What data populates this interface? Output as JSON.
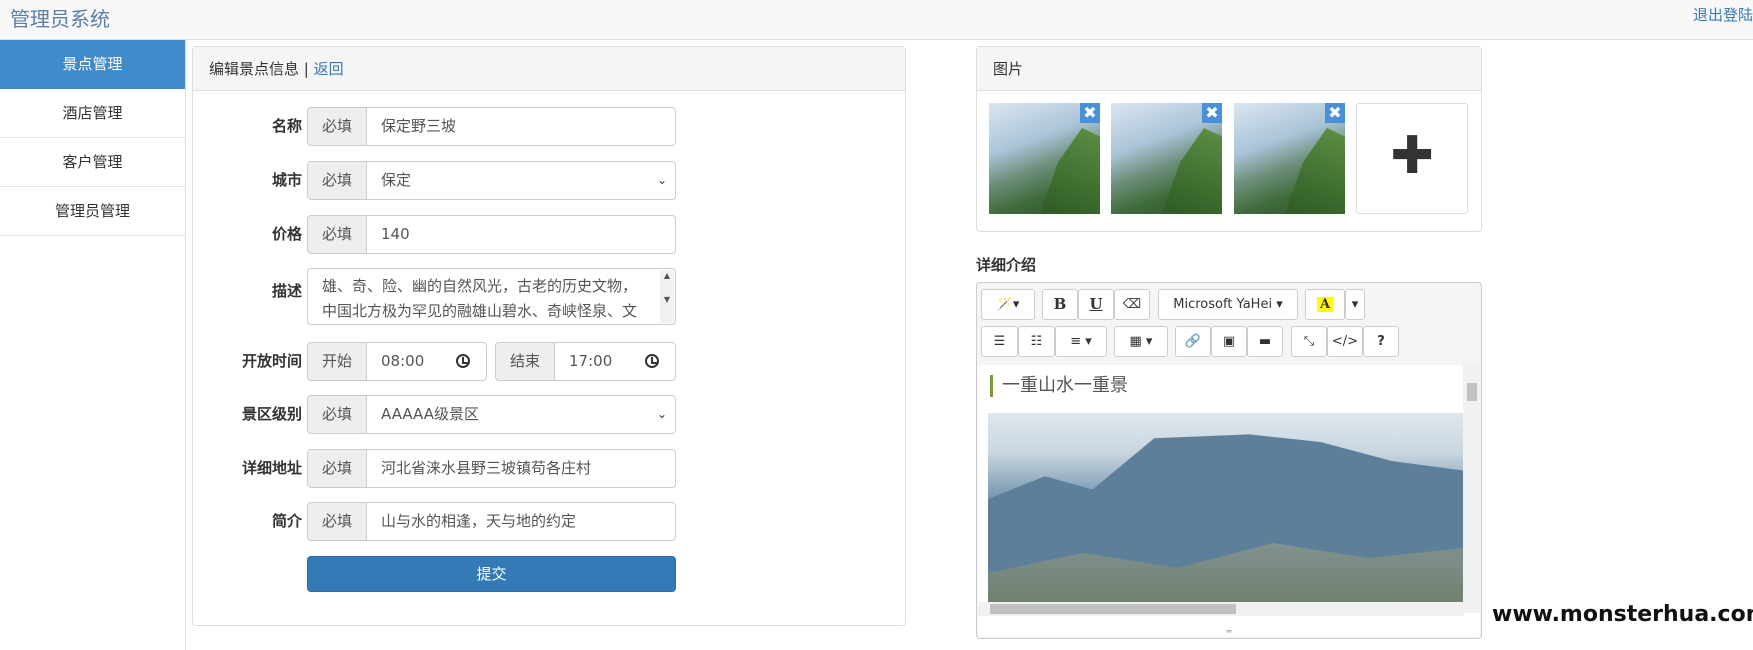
{
  "header": {
    "brand": "管理员系统",
    "logout": "退出登陆"
  },
  "sidebar": {
    "items": [
      {
        "label": "景点管理",
        "active": true
      },
      {
        "label": "酒店管理"
      },
      {
        "label": "客户管理"
      },
      {
        "label": "管理员管理"
      }
    ]
  },
  "form": {
    "title": "编辑景点信息",
    "back": "返回",
    "name": {
      "label": "名称",
      "addon": "必填",
      "value": "保定野三坡"
    },
    "city": {
      "label": "城市",
      "addon": "必填",
      "value": "保定"
    },
    "price": {
      "label": "价格",
      "addon": "必填",
      "value": "140"
    },
    "desc": {
      "label": "描述",
      "value": "雄、奇、险、幽的自然风光，古老的历史文物，中国北方极为罕见的融雄山碧水、奇峡怪泉、文物古迹、名树古禅于一身的风景名胜"
    },
    "open": {
      "label": "开放时间",
      "start_addon": "开始",
      "start": "08:00",
      "end_addon": "结束",
      "end": "17:00"
    },
    "level": {
      "label": "景区级别",
      "addon": "必填",
      "value": "AAAAA级景区"
    },
    "address": {
      "label": "详细地址",
      "addon": "必填",
      "value": "河北省涞水县野三坡镇苟各庄村"
    },
    "intro": {
      "label": "简介",
      "addon": "必填",
      "value": "山与水的相逢，天与地的约定"
    },
    "submit": "提交"
  },
  "images": {
    "title": "图片",
    "delete_glyph": "✖",
    "add_glyph": "✚"
  },
  "editor": {
    "section_label": "详细介绍",
    "toolbar": {
      "magic": "🪄▾",
      "bold": "B",
      "underline": "U",
      "eraser": "⌫",
      "font": "Microsoft YaHei ▾",
      "color": "A",
      "color_caret": "▾",
      "ul": "☰",
      "ol": "☷",
      "align": "≡ ▾",
      "table": "▦ ▾",
      "link": "🔗",
      "picture": "▣",
      "video": "▬",
      "fullscreen": "⤡",
      "code": "</>",
      "help": "?"
    },
    "content_heading": "一重山水一重景"
  },
  "watermark": "www.monsterhua.com"
}
